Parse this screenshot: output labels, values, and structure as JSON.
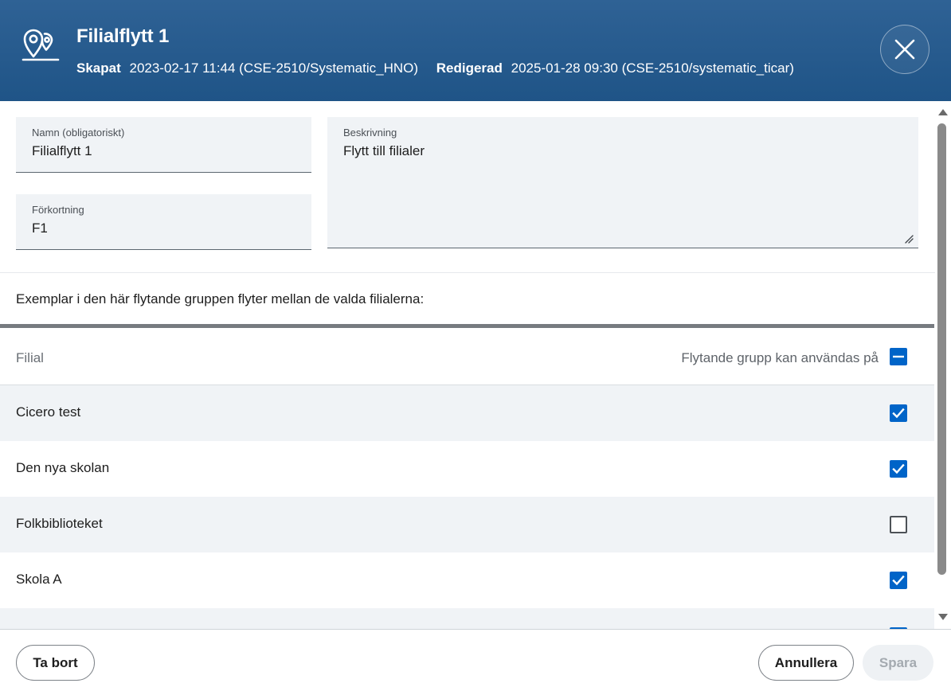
{
  "header": {
    "title": "Filialflytt 1",
    "icon": "map-location-pin-icon",
    "created_label": "Skapat",
    "created_value": "2023-02-17 11:44 (CSE-2510/Systematic_HNO)",
    "edited_label": "Redigerad",
    "edited_value": "2025-01-28 09:30 (CSE-2510/systematic_ticar)",
    "close_icon": "close-icon"
  },
  "form": {
    "name_label": "Namn (obligatoriskt)",
    "name_value": "Filialflytt 1",
    "abbr_label": "Förkortning",
    "abbr_value": "F1",
    "desc_label": "Beskrivning",
    "desc_value": "Flytt till filialer"
  },
  "intro_text": "Exemplar i den här flytande gruppen flyter mellan de valda filialerna:",
  "table": {
    "col_branch": "Filial",
    "col_usable": "Flytande grupp kan användas på",
    "header_checkbox_state": "indeterminate",
    "rows": [
      {
        "name": "Cicero test",
        "checked": true
      },
      {
        "name": "Den nya skolan",
        "checked": true
      },
      {
        "name": "Folkbiblioteket",
        "checked": false
      },
      {
        "name": "Skola A",
        "checked": true
      },
      {
        "name": "",
        "checked": true
      }
    ]
  },
  "footer": {
    "delete_label": "Ta bort",
    "cancel_label": "Annullera",
    "save_label": "Spara"
  },
  "colors": {
    "header_bg": "#1f5487",
    "checkbox_accent": "#0064c8",
    "row_alt_bg": "#f0f3f6"
  }
}
